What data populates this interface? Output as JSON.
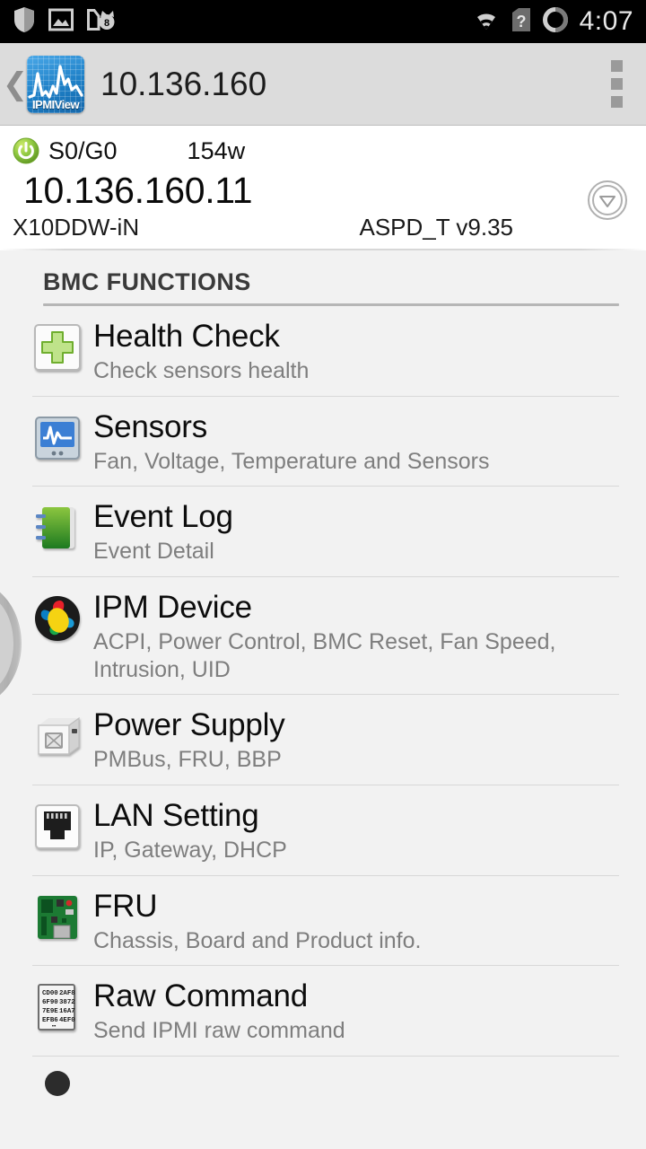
{
  "status_bar": {
    "icons": [
      "shield-icon",
      "photo-icon",
      "cat-badge-icon"
    ],
    "badge_count": "8",
    "right_icons": [
      "wifi-icon",
      "no-sim-icon",
      "battery-ring-icon"
    ],
    "clock": "4:07"
  },
  "action_bar": {
    "back_chevron": "❮",
    "app_icon_label": "IPMIView",
    "title": "10.136.160",
    "overflow_label": "More options"
  },
  "host_info": {
    "power_state": "S0/G0",
    "power_draw": "154w",
    "ip_address": "10.136.160.11",
    "model": "X10DDW-iN",
    "firmware": "ASPD_T v9.35",
    "expand_icon": "chevron-down-circle-icon"
  },
  "section": {
    "header": "BMC FUNCTIONS"
  },
  "functions": [
    {
      "icon": "health-cross-icon",
      "title": "Health Check",
      "subtitle": "Check sensors health"
    },
    {
      "icon": "sensors-monitor-icon",
      "title": "Sensors",
      "subtitle": "Fan, Voltage, Temperature and Sensors"
    },
    {
      "icon": "event-log-notebook-icon",
      "title": "Event Log",
      "subtitle": "Event Detail"
    },
    {
      "icon": "ipm-device-pinwheel-icon",
      "title": "IPM Device",
      "subtitle": "ACPI, Power Control, BMC Reset, Fan Speed, Intrusion, UID"
    },
    {
      "icon": "power-supply-icon",
      "title": "Power Supply",
      "subtitle": "PMBus, FRU, BBP"
    },
    {
      "icon": "lan-rj45-icon",
      "title": "LAN Setting",
      "subtitle": "IP, Gateway, DHCP"
    },
    {
      "icon": "fru-board-icon",
      "title": "FRU",
      "subtitle": "Chassis, Board and Product info."
    },
    {
      "icon": "raw-command-hex-icon",
      "title": "Raw Command",
      "subtitle": "Send IPMI raw command"
    }
  ],
  "raw_command_icon_text": {
    "rows": [
      [
        "CD00",
        "2AF8"
      ],
      [
        "6F90",
        "3872"
      ],
      [
        "7E9E",
        "16A7"
      ],
      [
        "EFB6",
        "4EF0"
      ]
    ],
    "ellipsis": "⋯"
  },
  "colors": {
    "status_bar_bg": "#000000",
    "action_bar_bg": "#dcdcdc",
    "list_bg": "#f2f2f2",
    "title_text": "#0d0d0d",
    "subtitle_text": "#7e7e7e",
    "accent_green": "#8cc63f",
    "logo_blue": "#1d7fc6"
  }
}
